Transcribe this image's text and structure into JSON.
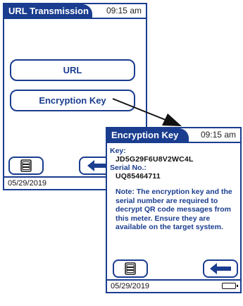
{
  "screen1": {
    "title": "URL Transmission",
    "time": "09:15 am",
    "buttons": {
      "url": "URL",
      "encryption_key": "Encryption Key"
    },
    "date": "05/29/2019"
  },
  "screen2": {
    "title": "Encryption Key",
    "time": "09:15 am",
    "key_label": "Key:",
    "key_value": "JD5G29F6U8V2WC4L",
    "serial_label": "Serial No.:",
    "serial_value": "UQ85464711",
    "note": "Note: The encryption key and the serial number are required to decrypt QR code messages from this meter. Ensure they are available on the target system.",
    "date": "05/29/2019"
  },
  "icons": [
    "menu-list-icon",
    "back-arrow-icon",
    "battery-icon",
    "pointer-arrow"
  ],
  "colors": {
    "accent": "#1a3d8f",
    "background": "#ffffff",
    "text": "#1a1a1a"
  }
}
